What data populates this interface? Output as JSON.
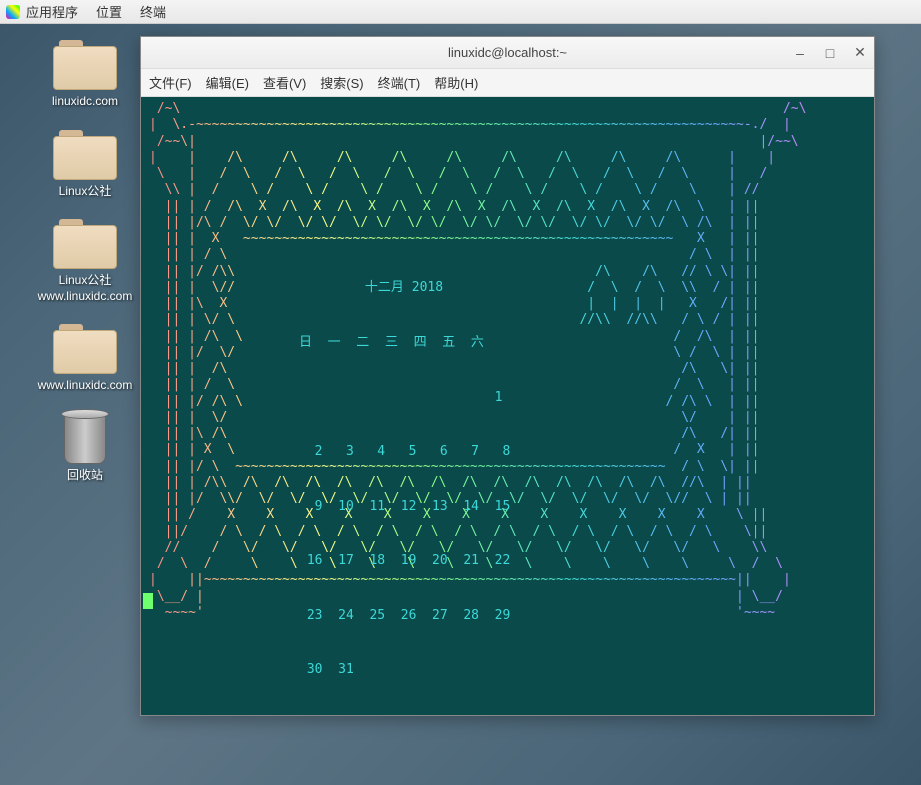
{
  "taskbar": {
    "apps": "应用程序",
    "places": "位置",
    "term": "终端"
  },
  "desktop": {
    "icons": [
      {
        "label": "linuxidc.com"
      },
      {
        "label": "Linux公社"
      },
      {
        "label": "Linux公社  www.linuxidc.com"
      },
      {
        "label": "www.linuxidc.com"
      }
    ],
    "trash": "回收站"
  },
  "window": {
    "title": "linuxidc@localhost:~",
    "menu": {
      "file": "文件(F)",
      "edit": "编辑(E)",
      "view": "查看(V)",
      "search": "搜索(S)",
      "terminal": "终端(T)",
      "help": "帮助(H)"
    }
  },
  "calendar": {
    "title": "十二月 2018",
    "weekdays": "日  一  二  三  四  五  六",
    "rows": [
      "                         1",
      "  2   3   4   5   6   7   8",
      "  9  10  11  12  13  14  15",
      " 16  17  18  19  20  21  22",
      " 23  24  25  26  27  28  29",
      " 30  31"
    ]
  },
  "ascii_art": " /~\\                                                                             /~\\\n|  \\.-~~~~~~~~~~~~~~~~~~~~~~~~~~~~~~~~~~~~~~~~~~~~~~~~~~~~~~~~~~~~~~~~~~~~~~-./  |\n /~~\\|                                                                        |/~~\\\n|    |    /\\     /\\     /\\     /\\     /\\     /\\     /\\     /\\     /\\      |    |\n \\   |   /  \\   /  \\   /  \\   /  \\   /  \\   /  \\   /  \\   /  \\   /  \\     |   /\n  \\\\ |  /    \\ /    \\ /    \\ /    \\ /    \\ /    \\ /    \\ /    \\ /    \\    | //\n  || | /  /\\  X  /\\  X  /\\  X  /\\  X  /\\  X  /\\  X  /\\  X  /\\  X  /\\  \\   | ||\n  || |/\\ /  \\/ \\/  \\/ \\/  \\/ \\/  \\/ \\/  \\/ \\/  \\/ \\/  \\/ \\/  \\/ \\/  \\ /\\  | ||\n  || |  X   ~~~~~~~~~~~~~~~~~~~~~~~~~~~~~~~~~~~~~~~~~~~~~~~~~~~~~~~   X   | ||\n  || | / \\                                                           / \\  | ||\n  || |/ /\\\\                                              /\\    /\\   // \\ \\| ||\n  || |  \\//                                             /  \\  /  \\  \\\\  / | ||\n  || |\\  X                                              |  |  |  |   X   /| ||\n  || | \\/ \\                                            //\\\\  //\\\\   / \\ / | ||\n  || | /\\  \\                                                       /  /\\  | ||\n  || |/  \\/                                                        \\ /  \\ | ||\n  || |  /\\                                                          /\\   \\| ||\n  || | /  \\                                                        /  \\   | ||\n  || |/ /\\ \\                                                      / /\\ \\  | ||\n  || |  \\/                                                          \\/    | ||\n  || |\\ /\\                                                          /\\   /| ||\n  || | X  \\                                                        /  X   | ||\n  || |/ \\  ~~~~~~~~~~~~~~~~~~~~~~~~~~~~~~~~~~~~~~~~~~~~~~~~~~~~~~~  / \\  \\| ||\n  || | /\\\\  /\\  /\\  /\\  /\\  /\\  /\\  /\\  /\\  /\\  /\\  /\\  /\\  /\\  /\\  //\\  | ||\n  || |/  \\\\/  \\/  \\/  \\/  \\/  \\/  \\/  \\/  \\/  \\/  \\/  \\/  \\/  \\/  \\//  \\ | ||\n  || /    X    X    X    X    X    X    X    X    X    X    X    X    X    \\ ||\n  ||/    / \\  / \\  / \\  / \\  / \\  / \\  / \\  / \\  / \\  / \\  / \\  / \\  / \\    \\||\n  //    /   \\/   \\/   \\/   \\/   \\/   \\/   \\/   \\/   \\/   \\/   \\/   \\/   \\    \\\\\n /  \\  /     \\    \\    \\    \\    \\    \\    \\    \\    \\    \\    \\    \\     \\  /  \\\n|    ||~~~~~~~~~~~~~~~~~~~~~~~~~~~~~~~~~~~~~~~~~~~~~~~~~~~~~~~~~~~~~~~~~~~~||    |\n \\__/ |                                                                    | \\__/\n  ~~~~'                                                                    '~~~~"
}
